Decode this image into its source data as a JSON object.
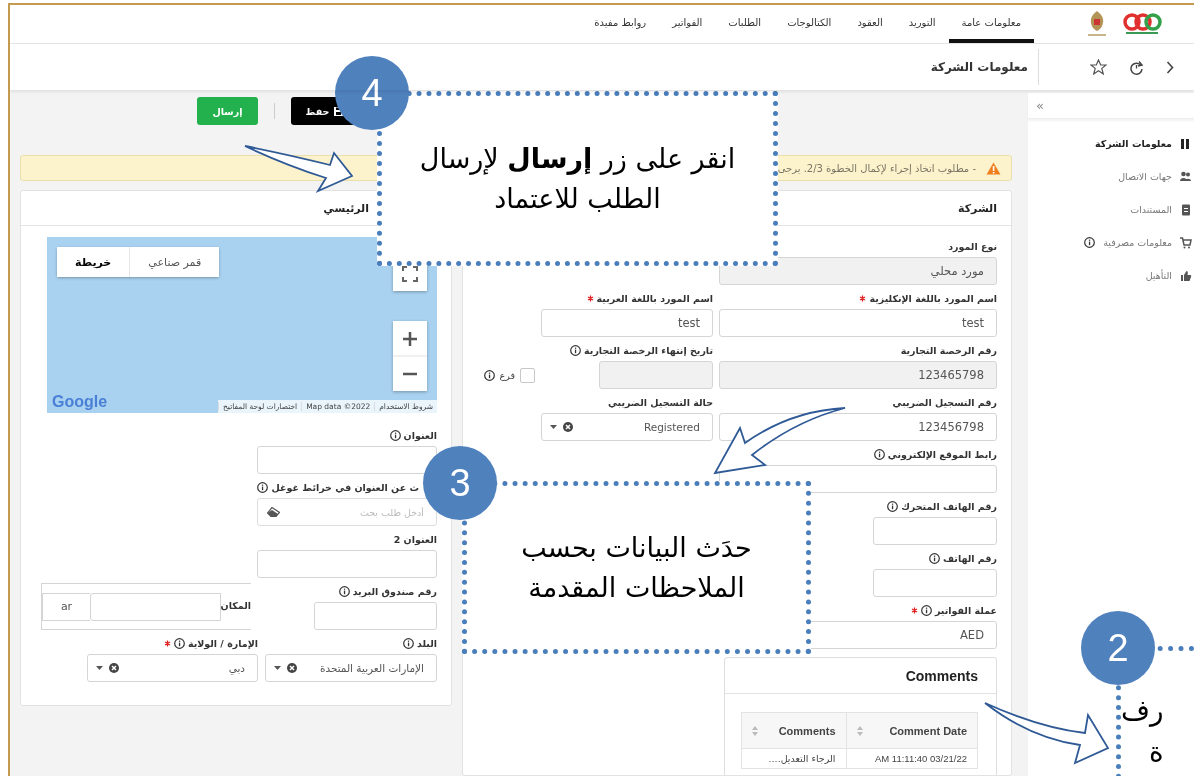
{
  "top_nav": {
    "items": [
      {
        "label": "معلومات عامة",
        "selected": true
      },
      {
        "label": "التوريد",
        "selected": false
      },
      {
        "label": "العقود",
        "selected": false
      },
      {
        "label": "الكتالوجات",
        "selected": false
      },
      {
        "label": "الطلبات",
        "selected": false
      },
      {
        "label": "الفواتير",
        "selected": false
      },
      {
        "label": "روابط مفيدة",
        "selected": false
      }
    ]
  },
  "page_title": "معلومات الشركة",
  "sidebar": {
    "toggle": "»",
    "items": [
      {
        "label": "معلومات الشركة",
        "selected": true,
        "info": false
      },
      {
        "label": "جهات الاتصال",
        "selected": false,
        "info": false
      },
      {
        "label": "المستندات",
        "selected": false,
        "info": false
      },
      {
        "label": "معلومات مصرفية",
        "selected": false,
        "info": true
      },
      {
        "label": "التأهيل",
        "selected": false,
        "info": false
      }
    ]
  },
  "actions": [
    {
      "kind": "save",
      "label": "حفظ"
    },
    {
      "kind": "submit",
      "label": "إرسال"
    }
  ],
  "alert": {
    "text": "- مطلوب اتخاذ إجراء لإكمال الخطوة 2/3. يرجى"
  },
  "company_panel": {
    "title": "الشركة",
    "rows": [
      {
        "fields": [
          {
            "kind": "text",
            "label": "نوع المورد",
            "required": false,
            "info": false,
            "disabled": true,
            "value": "مورد محلي"
          }
        ]
      },
      {
        "fields": [
          {
            "kind": "text",
            "label": "اسم المورد باللغة الإنكليزية",
            "required": true,
            "info": false,
            "disabled": false,
            "value": "test"
          },
          {
            "kind": "text",
            "label": "اسم المورد باللغة العربية",
            "required": true,
            "info": false,
            "disabled": false,
            "value": "test"
          }
        ]
      },
      {
        "fields": [
          {
            "kind": "text",
            "label": "رقم الرخصة التجارية",
            "required": false,
            "info": false,
            "disabled": true,
            "value": "123465798"
          },
          {
            "kind": "date",
            "label": "تاريخ إنتهاء الرخصة التجارية",
            "required": false,
            "info": true,
            "disabled": true
          },
          {
            "kind": "checkbox",
            "label": "فرع",
            "info": true,
            "checked": false
          }
        ]
      },
      {
        "fields": [
          {
            "kind": "text",
            "label": "رقم التسجيل الضريبي",
            "required": false,
            "info": false,
            "disabled": false,
            "value": "123456798"
          },
          {
            "kind": "select",
            "label": "حالة التسجيل الضريبي",
            "required": false,
            "info": false,
            "value": "Registered"
          }
        ]
      },
      {
        "fields": [
          {
            "kind": "text",
            "label": "رابط الموقع الإلكتروني",
            "required": false,
            "info": true,
            "disabled": false
          }
        ]
      },
      {
        "fields": [
          {
            "kind": "phone",
            "label": "رقم الهاتف المتحرك",
            "required": false,
            "info": true,
            "disabled": false
          }
        ]
      },
      {
        "fields": [
          {
            "kind": "phone",
            "label": "رقم الهاتف",
            "required": false,
            "info": true,
            "disabled": false
          }
        ]
      },
      {
        "fields": [
          {
            "kind": "text",
            "label": "عملة الفواتير",
            "required": true,
            "info": true,
            "disabled": false,
            "value": "AED"
          }
        ]
      }
    ]
  },
  "comments": {
    "title": "Comments",
    "columns": [
      {
        "label": "Comment Date"
      },
      {
        "label": "Comments"
      }
    ],
    "rows": [
      [
        "AM 11:11:40 03/21/22",
        "الرجاء التعديل...."
      ]
    ]
  },
  "location_panel": {
    "title": "الرئيسي",
    "map": {
      "types": [
        {
          "label": "قمر صناعي",
          "selected": false
        },
        {
          "label": "خريطة",
          "selected": true
        }
      ],
      "logo": "Google",
      "attribution": [
        "شروط الاستخدام",
        "Map data ©2022",
        "اختصارات لوحة المفاتيح"
      ]
    },
    "rows": [
      {
        "fields": [
          {
            "kind": "text",
            "label": "العنوان",
            "required": false,
            "info": true,
            "disabled": false
          }
        ]
      },
      {
        "fields": [
          {
            "kind": "search",
            "label": "ث عن العنوان في خرائط غوغل",
            "required": false,
            "info": true,
            "placeholder": "أدخل طلب بحث"
          }
        ]
      },
      {
        "fields": [
          {
            "kind": "text",
            "label": "العنوان 2",
            "required": false,
            "info": false,
            "disabled": false
          }
        ]
      },
      {
        "fields": [
          {
            "kind": "text",
            "label": "رقم صندوق البريد",
            "required": false,
            "info": true,
            "disabled": false
          },
          {
            "kind": "text",
            "label": "المكان",
            "required": false,
            "info": false,
            "disabled": false,
            "addon": "ar"
          }
        ]
      },
      {
        "fields": [
          {
            "kind": "select",
            "label": "البلد",
            "required": false,
            "info": true,
            "value": "الإمارات العربية المتحدة"
          },
          {
            "kind": "select",
            "label": "الإمارة / الولاية",
            "required": true,
            "info": true,
            "value": "دبي"
          }
        ]
      }
    ]
  },
  "callouts": [
    {
      "number": "4",
      "lines": [
        "انقر على زر **إرسال** لإرسال",
        "الطلب للاعتماد"
      ]
    },
    {
      "number": "3",
      "lines": [
        "حدَث البيانات بحسب",
        "الملاحظات المقدمة"
      ]
    },
    {
      "number": "2",
      "lines": [
        "رف",
        "ة"
      ]
    }
  ]
}
